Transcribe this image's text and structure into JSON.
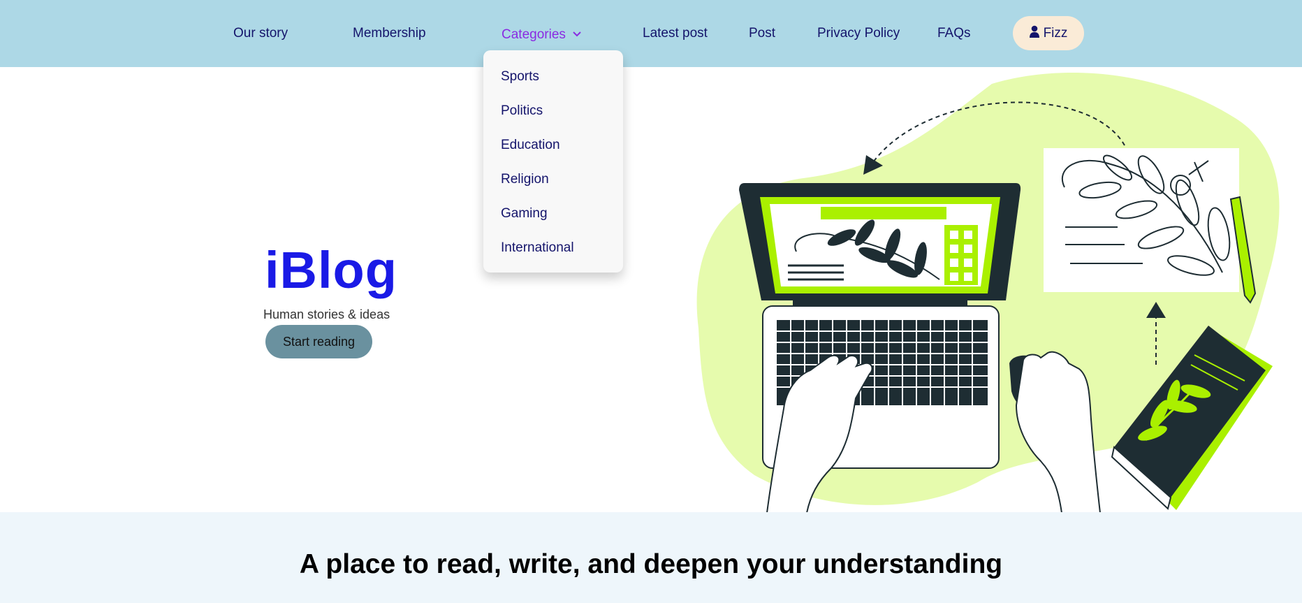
{
  "nav": {
    "links": [
      "Our story",
      "Membership",
      "Categories",
      "Latest post",
      "Post",
      "Privacy Policy",
      "FAQs"
    ],
    "user": {
      "label": "Fizz",
      "icon": "user-icon"
    },
    "colors": {
      "bar": "#add8e6",
      "link": "#14146b",
      "active": "#8a2be2",
      "user_btn": "#faebd7"
    }
  },
  "dropdown": {
    "items": [
      "Sports",
      "Politics",
      "Education",
      "Religion",
      "Gaming",
      "International"
    ]
  },
  "hero": {
    "brand": "iBlog",
    "tagline": "Human stories & ideas",
    "cta": "Start reading",
    "colors": {
      "brand": "#1a1ae6",
      "cta": "#6a919f",
      "blob": "#e6fbad",
      "accent": "#aaf000",
      "ink": "#1e2d33"
    }
  },
  "bottom": {
    "heading": "A place to read, write, and deepen your understanding"
  }
}
